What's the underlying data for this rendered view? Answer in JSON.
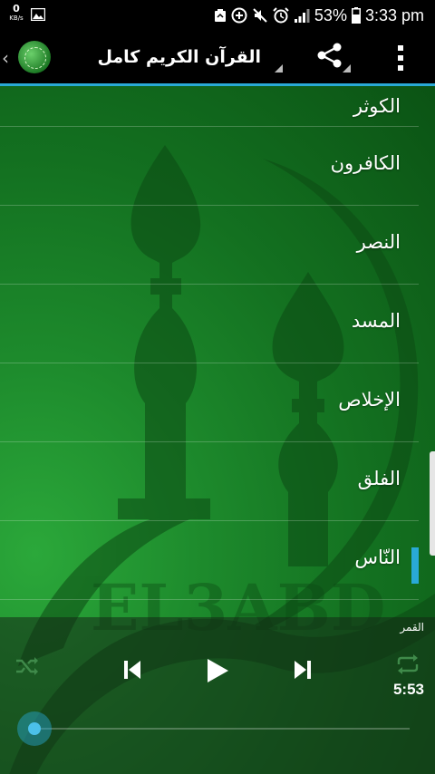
{
  "status_bar": {
    "net_speed_value": "0",
    "net_speed_unit": "KB/s",
    "battery_percent": "53%",
    "time": "3:33 pm"
  },
  "app_bar": {
    "title": "القرآن الكريم كامل",
    "icons": [
      "logo-icon",
      "share-icon",
      "overflow-menu-icon"
    ]
  },
  "surah_list": {
    "items": [
      {
        "label": "الكوثر",
        "active": false
      },
      {
        "label": "الكافرون",
        "active": false
      },
      {
        "label": "النصر",
        "active": false
      },
      {
        "label": "المسد",
        "active": false
      },
      {
        "label": "الإخلاص",
        "active": false
      },
      {
        "label": "الفلق",
        "active": false
      },
      {
        "label": "النّاس",
        "active": true
      }
    ]
  },
  "player": {
    "now_playing": "القمر",
    "duration": "5:53",
    "progress": 0.0,
    "icons": [
      "shuffle-icon",
      "previous-icon",
      "play-icon",
      "next-icon",
      "repeat-icon"
    ]
  },
  "colors": {
    "accent": "#29a9d6",
    "background_green": "#1d8a2c",
    "app_bar": "#000000"
  }
}
